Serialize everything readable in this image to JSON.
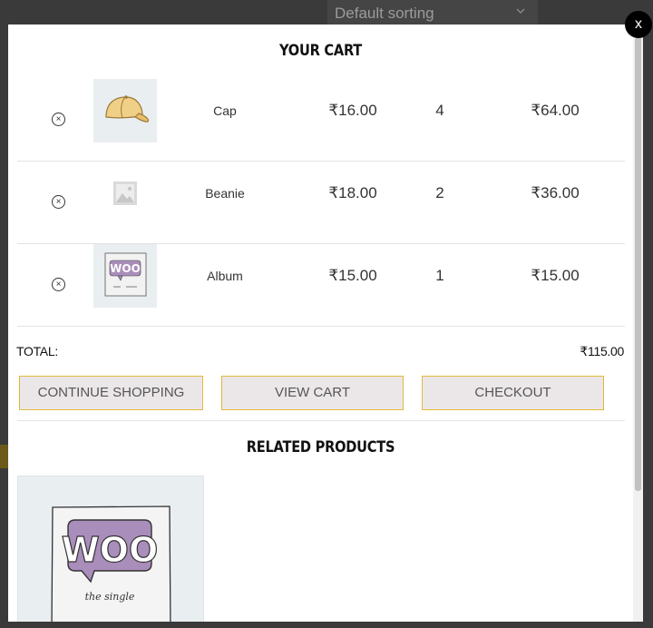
{
  "background": {
    "sorting_select": "Default sorting"
  },
  "modal": {
    "close_label": "x",
    "title": "YOUR CART",
    "items": [
      {
        "name": "Cap",
        "price": "₹16.00",
        "qty": "4",
        "subtotal": "₹64.00",
        "thumb_icon": "cap-icon"
      },
      {
        "name": "Beanie",
        "price": "₹18.00",
        "qty": "2",
        "subtotal": "₹36.00",
        "thumb_icon": "placeholder-image-icon"
      },
      {
        "name": "Album",
        "price": "₹15.00",
        "qty": "1",
        "subtotal": "₹15.00",
        "thumb_icon": "woo-album-icon"
      }
    ],
    "remove_symbol": "×",
    "total_label": "TOTAL:",
    "total_value": "₹115.00",
    "buttons": {
      "continue": "CONTINUE SHOPPING",
      "view_cart": "VIEW CART",
      "checkout": "CHECKOUT"
    },
    "related_title": "RELATED PRODUCTS",
    "related_products": [
      {
        "art_text": "WOO",
        "art_subtext": "the single",
        "icon": "woo-single-icon"
      }
    ]
  },
  "colors": {
    "accent_border": "#e2b93b",
    "button_bg": "#ebe7e8",
    "woo_purple": "#a98dba"
  }
}
